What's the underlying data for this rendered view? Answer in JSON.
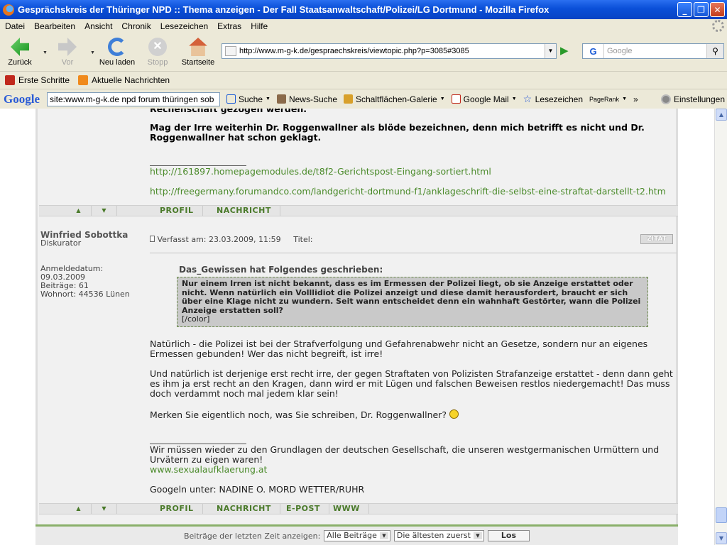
{
  "window": {
    "title": "Gesprächskreis der Thüringer NPD :: Thema anzeigen - Der Fall Staatsanwaltschaft/Polizei/LG Dortmund - Mozilla Firefox",
    "controls": [
      "_",
      "❐",
      "✕"
    ]
  },
  "menu": [
    "Datei",
    "Bearbeiten",
    "Ansicht",
    "Chronik",
    "Lesezeichen",
    "Extras",
    "Hilfe"
  ],
  "nav": {
    "back": "Zurück",
    "forward": "Vor",
    "reload": "Neu laden",
    "stop": "Stopp",
    "home": "Startseite",
    "url": "http://www.m-g-k.de/gespraechskreis/viewtopic.php?p=3085#3085",
    "search_placeholder": "Google",
    "search_engine_glyph": "G"
  },
  "bookmarks": [
    "Erste Schritte",
    "Aktuelle Nachrichten"
  ],
  "google_toolbar": {
    "logo": "Google",
    "query": "site:www.m-g-k.de npd forum thüringen sob",
    "search": "Suche",
    "news": "News-Suche",
    "buttons": "Schaltflächen-Galerie",
    "gmail": "Google Mail",
    "bookmarks": "Lesezeichen",
    "pagerank": "PageRank",
    "more": "»",
    "settings": "Einstellungen"
  },
  "post1": {
    "cut_line": "Rechenschaft gezogen werden.",
    "bold_para": "Mag der Irre weiterhin Dr. Roggenwallner als blöde bezeichnen, denn mich betrifft es nicht und Dr. Roggenwallner hat schon geklagt.",
    "link1": "http://161897.homepagemodules.de/t8f2-Gerichtspost-Eingang-sortiert.html",
    "link2": "http://freegermany.forumandco.com/landgericht-dortmund-f1/anklageschrift-die-selbst-eine-straftat-darstellt-t2.htm",
    "buttons": [
      "PROFIL",
      "NACHRICHT"
    ]
  },
  "post2": {
    "author": "Winfried Sobottka",
    "rank": "Diskurator",
    "joined_label": "Anmeldedatum:",
    "joined": "09.03.2009",
    "posts": "Beiträge: 61",
    "location": "Wohnort: 44536 Lünen",
    "meta": "Verfasst am: 23.03.2009, 11:59",
    "title_label": "Titel:",
    "quote_button": "ZITAT",
    "quote_title": "Das_Gewissen hat Folgendes geschrieben:",
    "quote_text": "Nur einem Irren ist nicht bekannt, dass es im Ermessen der Polizei liegt, ob sie Anzeige erstattet oder nicht. Wenn natürlich ein Volllidiot die Polizei anzeigt und diese damit herausfordert, braucht er sich über eine Klage nicht zu wundern. Seit wann entscheidet denn ein wahnhaft Gestörter, wann die Polizei Anzeige erstatten soll?",
    "quote_tail": "[/color]",
    "para1": "Natürlich - die Polizei ist bei der Strafverfolgung und Gefahrenabwehr nicht an Gesetze, sondern nur an eigenes Ermessen gebunden! Wer das nicht begreift, ist irre!",
    "para2": "Und natürlich ist derjenige erst recht irre, der gegen Straftaten von Polizisten Strafanzeige erstattet - denn dann geht es ihm ja erst recht an den Kragen, dann wird er mit Lügen und falschen Beweisen restlos niedergemacht! Das muss doch verdammt noch mal jedem klar sein!",
    "para3": "Merken Sie eigentlich noch, was Sie schreiben, Dr. Roggenwallner?",
    "sig1": "Wir müssen wieder zu den Grundlagen der deutschen Gesellschaft, die unseren westgermanischen Urmüttern und Urvätern zu eigen waren!",
    "sig_link": "www.sexualaufklaerung.at",
    "sig2": "Googeln unter: NADINE O. MORD WETTER/RUHR",
    "buttons": [
      "PROFIL",
      "NACHRICHT",
      "E-POST",
      "WWW"
    ]
  },
  "footer": {
    "label": "Beiträge der letzten Zeit anzeigen:",
    "sel1": "Alle Beiträge",
    "sel2": "Die ältesten zuerst",
    "go": "Los"
  }
}
